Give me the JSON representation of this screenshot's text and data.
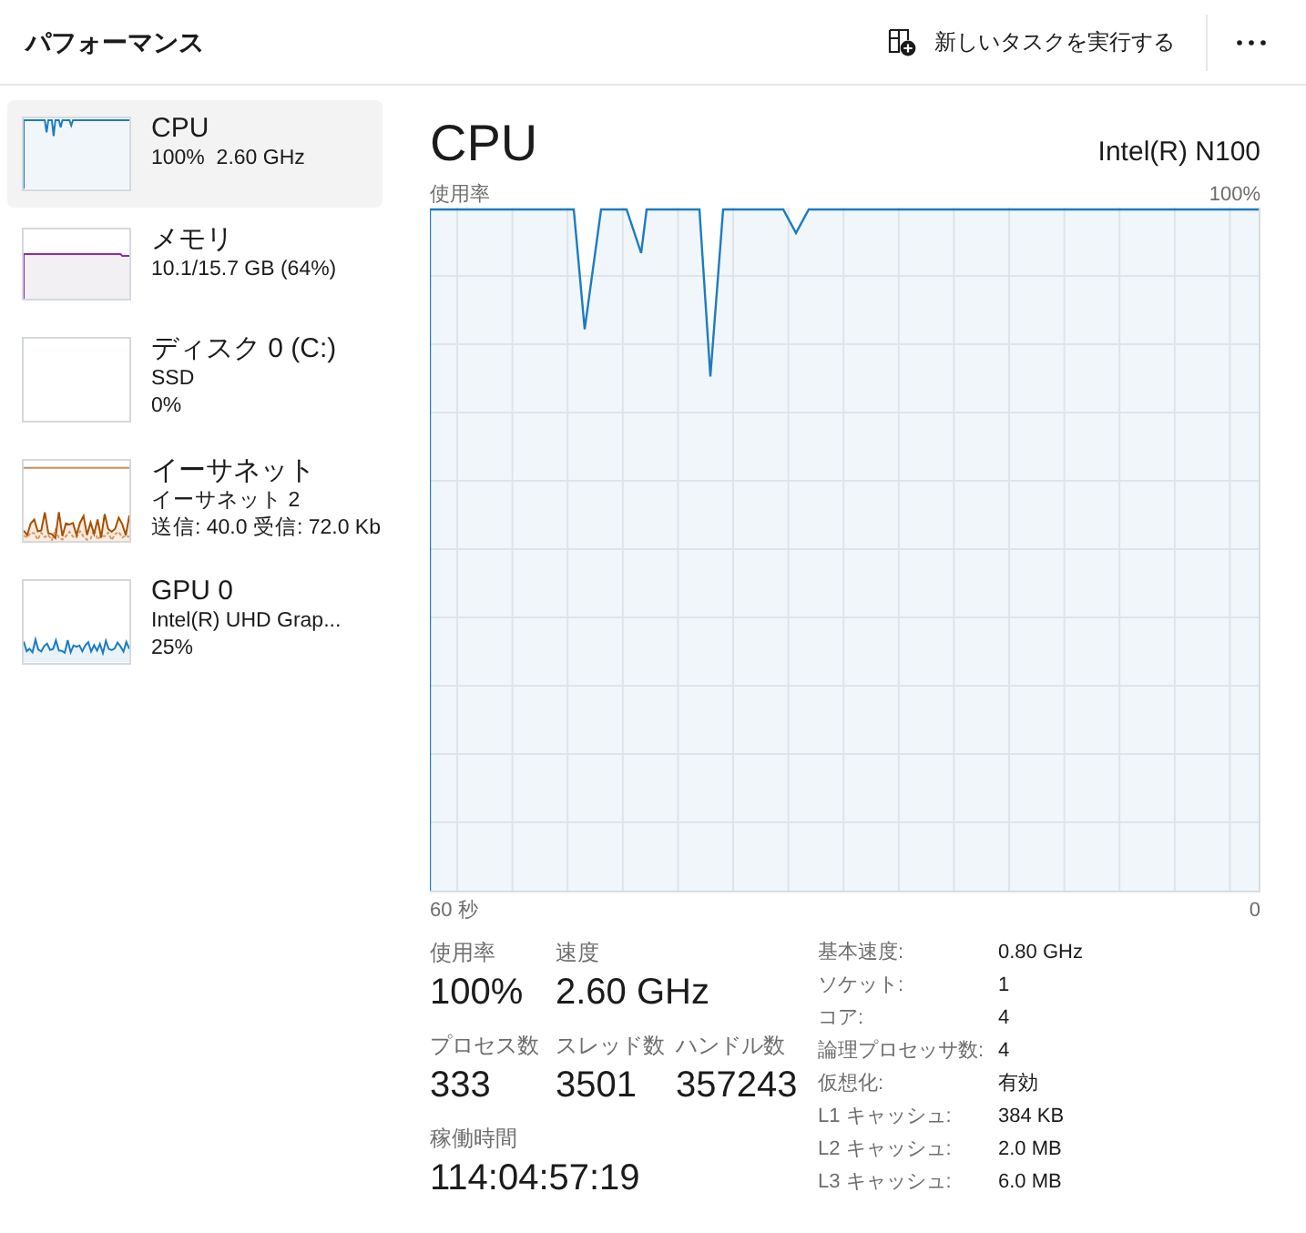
{
  "header": {
    "title": "パフォーマンス",
    "run_task_button": "新しいタスクを実行する"
  },
  "sidebar": {
    "items": [
      {
        "kind": "cpu",
        "title": "CPU",
        "lines": [
          "100%  2.60 GHz"
        ],
        "selected": true
      },
      {
        "kind": "memory",
        "title": "メモリ",
        "lines": [
          "10.1/15.7 GB (64%)"
        ],
        "selected": false
      },
      {
        "kind": "disk",
        "title": "ディスク 0 (C:)",
        "lines": [
          "SSD",
          "0%"
        ],
        "selected": false
      },
      {
        "kind": "ethernet",
        "title": "イーサネット",
        "lines": [
          "イーサネット 2",
          "送信: 40.0 受信: 72.0 Kb"
        ],
        "selected": false
      },
      {
        "kind": "gpu",
        "title": "GPU 0",
        "lines": [
          "Intel(R) UHD Grap...",
          "25%"
        ],
        "selected": false
      }
    ]
  },
  "detail": {
    "title": "CPU",
    "model": "Intel(R) N100",
    "graph": {
      "top_left_label": "使用率",
      "top_right_label": "100%",
      "bottom_left_label": "60 秒",
      "bottom_right_label": "0"
    },
    "stats": [
      [
        {
          "label": "使用率",
          "value": "100%"
        },
        {
          "label": "速度",
          "value": "2.60 GHz"
        }
      ],
      [
        {
          "label": "プロセス数",
          "value": "333"
        },
        {
          "label": "スレッド数",
          "value": "3501"
        },
        {
          "label": "ハンドル数",
          "value": "357243"
        }
      ],
      [
        {
          "label": "稼働時間",
          "value": "114:04:57:19"
        }
      ]
    ],
    "specs": [
      {
        "label": "基本速度:",
        "value": "0.80 GHz"
      },
      {
        "label": "ソケット:",
        "value": "1"
      },
      {
        "label": "コア:",
        "value": "4"
      },
      {
        "label": "論理プロセッサ数:",
        "value": "4"
      },
      {
        "label": "仮想化:",
        "value": "有効"
      },
      {
        "label": "L1 キャッシュ:",
        "value": "384 KB"
      },
      {
        "label": "L2 キャッシュ:",
        "value": "2.0 MB"
      },
      {
        "label": "L3 キャッシュ:",
        "value": "6.0 MB"
      }
    ]
  }
}
